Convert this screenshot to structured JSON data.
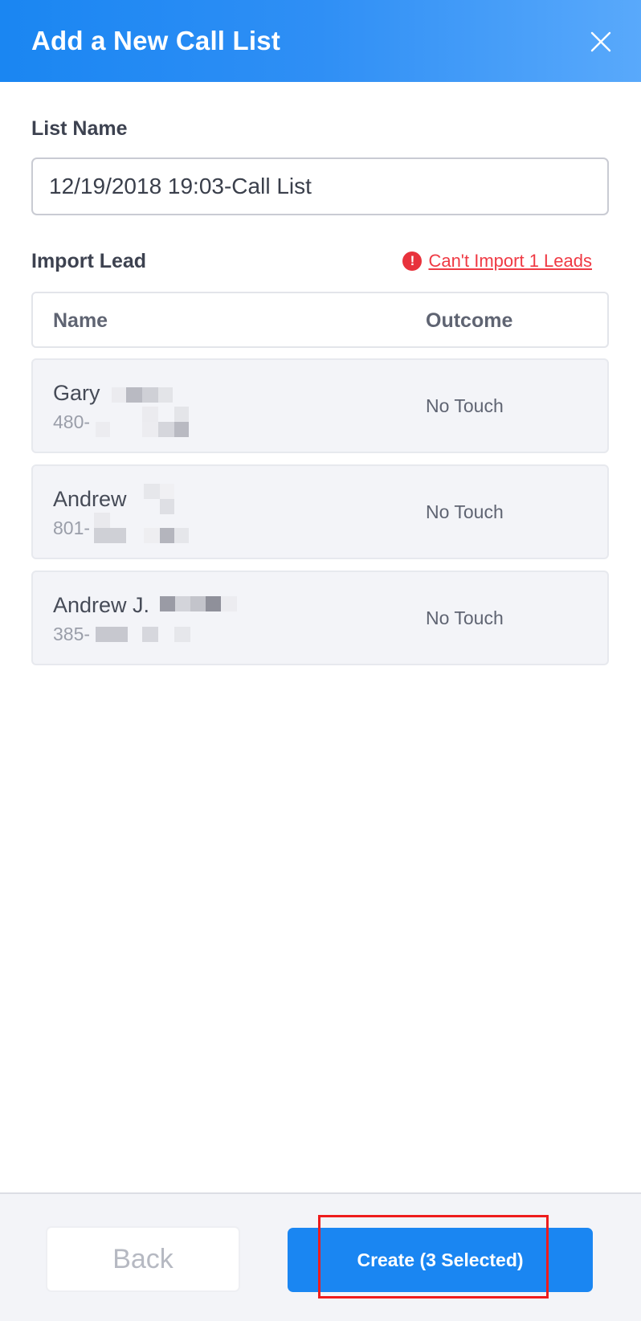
{
  "header": {
    "title": "Add a New Call List",
    "close_icon": "close-icon"
  },
  "list_name": {
    "label": "List Name",
    "value": "12/19/2018 19:03-Call List"
  },
  "import": {
    "label": "Import Lead",
    "warning_icon": "error-icon",
    "warning_text": "Can't Import 1 Leads",
    "warning_color": "#ef3a44"
  },
  "table": {
    "columns": [
      "Name",
      "Outcome"
    ],
    "rows": [
      {
        "name": "Gary",
        "phone": "480-",
        "outcome": "No Touch"
      },
      {
        "name": "Andrew",
        "phone": "801-",
        "outcome": "No Touch"
      },
      {
        "name": "Andrew J.",
        "phone": "385-",
        "outcome": "No Touch"
      }
    ]
  },
  "footer": {
    "back_label": "Back",
    "create_label": "Create (3 Selected)",
    "accent": "#1a86f2"
  }
}
